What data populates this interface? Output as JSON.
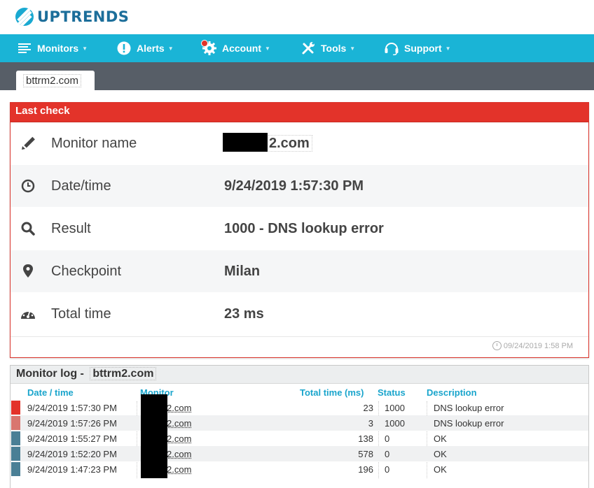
{
  "brand": {
    "name": "UPTRENDS",
    "color": "#1c6e9a",
    "accent": "#1ab4d6"
  },
  "nav": [
    {
      "label": "Monitors",
      "icon": "list-icon"
    },
    {
      "label": "Alerts",
      "icon": "alert-icon"
    },
    {
      "label": "Account",
      "icon": "gear-icon"
    },
    {
      "label": "Tools",
      "icon": "tools-icon"
    },
    {
      "label": "Support",
      "icon": "headset-icon"
    }
  ],
  "tab": {
    "label": "bttrm2.com"
  },
  "last_check": {
    "title": "Last check",
    "rows": [
      {
        "label": "Monitor name",
        "value": "2.com",
        "icon": "pencil-icon"
      },
      {
        "label": "Date/time",
        "value": "9/24/2019 1:57:30 PM",
        "icon": "clock-icon"
      },
      {
        "label": "Result",
        "value": "1000 - DNS lookup error",
        "icon": "search-icon"
      },
      {
        "label": "Checkpoint",
        "value": "Milan",
        "icon": "location-pin-icon"
      },
      {
        "label": "Total time",
        "value": "23 ms",
        "icon": "speedometer-icon"
      }
    ],
    "timestamp": "09/24/2019 1:58 PM",
    "status_color": "#e3332a"
  },
  "monitor_log": {
    "title": "Monitor log -",
    "domain": "bttrm2.com",
    "columns": [
      "Date / time",
      "Monitor",
      "Total time (ms)",
      "Status",
      "Description"
    ],
    "rows": [
      {
        "datetime": "9/24/2019 1:57:30 PM",
        "monitor": "2.com",
        "total_time": "23",
        "status": "1000",
        "description": "DNS lookup error",
        "color": "#e3332a"
      },
      {
        "datetime": "9/24/2019 1:57:26 PM",
        "monitor": "2.com",
        "total_time": "3",
        "status": "1000",
        "description": "DNS lookup error",
        "color": "#d9766f"
      },
      {
        "datetime": "9/24/2019 1:55:27 PM",
        "monitor": "2.com",
        "total_time": "138",
        "status": "0",
        "description": "OK",
        "color": "#4a7f95"
      },
      {
        "datetime": "9/24/2019 1:52:20 PM",
        "monitor": "2.com",
        "total_time": "578",
        "status": "0",
        "description": "OK",
        "color": "#4a7f95"
      },
      {
        "datetime": "9/24/2019 1:47:23 PM",
        "monitor": "2.com",
        "total_time": "196",
        "status": "0",
        "description": "OK",
        "color": "#4a7f95"
      }
    ]
  }
}
